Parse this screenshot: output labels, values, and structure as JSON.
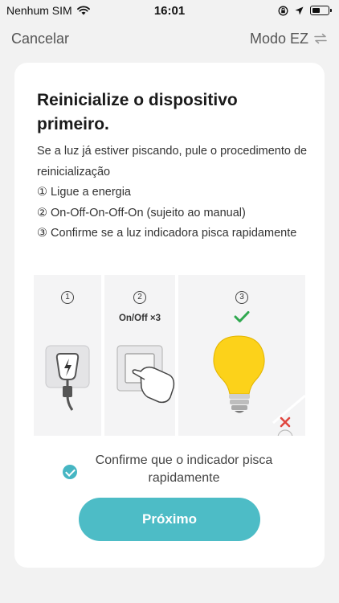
{
  "status_bar": {
    "carrier": "Nenhum SIM",
    "time": "16:01"
  },
  "nav": {
    "cancel_label": "Cancelar",
    "mode_label": "Modo EZ"
  },
  "card": {
    "title": "Reinicialize o dispositivo primeiro.",
    "instructions": [
      "Se a luz já estiver piscando, pule o procedimento de reinicialização",
      "① Ligue a energia",
      "② On-Off-On-Off-On (sujeito ao manual)",
      "③ Confirme se a luz indicadora pisca rapidamente"
    ],
    "steps": [
      {
        "number": "1",
        "caption": ""
      },
      {
        "number": "2",
        "caption": "On/Off ×3"
      },
      {
        "number": "3",
        "caption": ""
      }
    ],
    "confirm_text": "Confirme que o indicador pisca rapidamente",
    "confirm_checked": true,
    "next_label": "Próximo"
  },
  "colors": {
    "accent": "#4dbcc6",
    "check_green": "#2fa84f",
    "bulb_yellow": "#fcd21a",
    "cross_red": "#e0463f"
  },
  "icons": [
    "wifi-icon",
    "lock-rotation-icon",
    "location-icon",
    "battery-icon",
    "swap-icon",
    "power-plug-icon",
    "light-switch-icon",
    "light-bulb-icon",
    "check-icon",
    "close-icon"
  ]
}
